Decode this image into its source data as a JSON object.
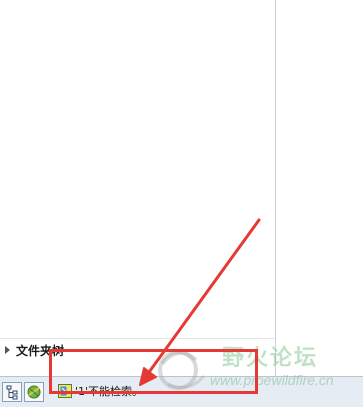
{
  "folder_browser": {
    "label": "文件夹树",
    "expand_icon": "triangle-right-icon"
  },
  "status_bar": {
    "buttons": [
      {
        "icon": "model-tree-icon"
      },
      {
        "icon": "favorites-globe-icon"
      }
    ],
    "message": {
      "icon": "warning-message-icon",
      "text": "'1'不能检索。"
    }
  },
  "annotation": {
    "color": "#e53935"
  },
  "watermark": {
    "name": "野火论坛",
    "url": "www.proewildfire.cn"
  }
}
